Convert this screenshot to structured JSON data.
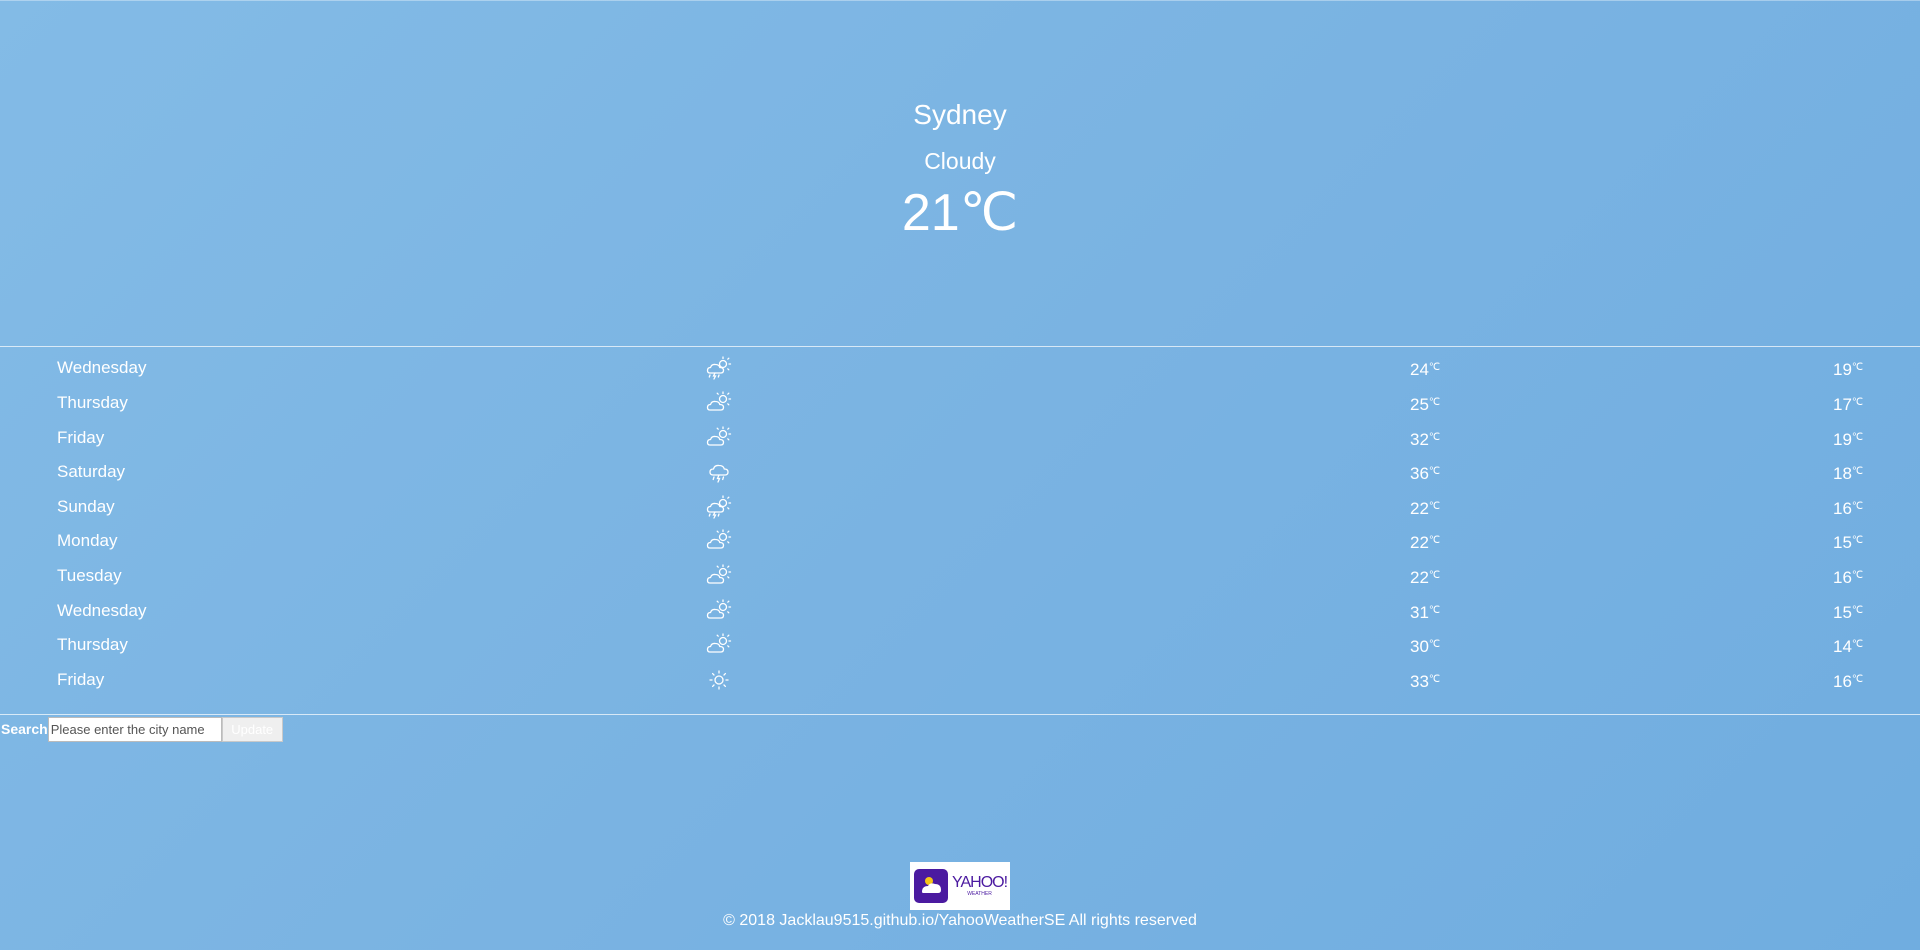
{
  "current": {
    "city": "Sydney",
    "condition": "Cloudy",
    "temperature": "21",
    "unit": "℃"
  },
  "forecast": [
    {
      "day": "Wednesday",
      "icon": "thunder-shower-icon",
      "high": "24",
      "low": "19",
      "unit": "℃"
    },
    {
      "day": "Thursday",
      "icon": "partly-cloudy-icon",
      "high": "25",
      "low": "17",
      "unit": "℃"
    },
    {
      "day": "Friday",
      "icon": "partly-cloudy-icon",
      "high": "32",
      "low": "19",
      "unit": "℃"
    },
    {
      "day": "Saturday",
      "icon": "thunderstorm-icon",
      "high": "36",
      "low": "18",
      "unit": "℃"
    },
    {
      "day": "Sunday",
      "icon": "thunder-shower-icon",
      "high": "22",
      "low": "16",
      "unit": "℃"
    },
    {
      "day": "Monday",
      "icon": "partly-cloudy-icon",
      "high": "22",
      "low": "15",
      "unit": "℃"
    },
    {
      "day": "Tuesday",
      "icon": "partly-cloudy-icon",
      "high": "22",
      "low": "16",
      "unit": "℃"
    },
    {
      "day": "Wednesday",
      "icon": "partly-cloudy-icon",
      "high": "31",
      "low": "15",
      "unit": "℃"
    },
    {
      "day": "Thursday",
      "icon": "partly-cloudy-icon",
      "high": "30",
      "low": "14",
      "unit": "℃"
    },
    {
      "day": "Friday",
      "icon": "sunny-icon",
      "high": "33",
      "low": "16",
      "unit": "℃"
    }
  ],
  "search": {
    "label": "Search",
    "placeholder": "Please enter the city name",
    "button_label": "Update"
  },
  "footer": {
    "logo_text": "YAHOO!",
    "logo_subtext": "WEATHER",
    "copyright": "© 2018 Jacklau9515.github.io/YahooWeatherSE All rights reserved"
  },
  "colors": {
    "background": "#7ab3e2",
    "text": "#ffffff",
    "brand": "#4b1aa0"
  }
}
